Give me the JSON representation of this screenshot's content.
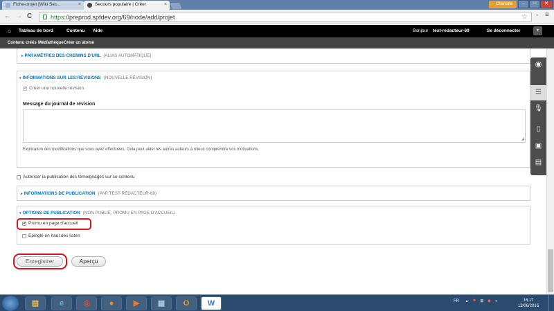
{
  "browser": {
    "tabs": [
      {
        "label": "Fiche-projet [Wiki Sec..."
      },
      {
        "label": "Secours populaire | Créer"
      }
    ],
    "tab_close": "×",
    "user_badge": "Charlotte",
    "window_controls": {
      "minimize": "–",
      "maximize": "□",
      "close": "✕"
    },
    "nav": {
      "back": "←",
      "forward": "→",
      "reload": "C"
    },
    "url_https": "https",
    "url_rest": "://preprod.spfdev.org/69/node/add/projet",
    "bookmark_star": "☆",
    "menu_icon": "≡"
  },
  "admin_toolbar": {
    "home_icon": "⌂",
    "items": [
      "Tableau de bord",
      "Contenu",
      "Aide"
    ],
    "greeting_prefix": "Bonjour",
    "username": "test-redacteur-69",
    "logout": "Se déconnecter"
  },
  "shortcuts": [
    "Contenu créés",
    "Médiathèque",
    "Créer un atome"
  ],
  "form": {
    "url_paths": {
      "title": "Paramètres des chemins d'URL",
      "summary": "(Alias automatique)"
    },
    "revisions": {
      "title": "Informations sur les révisions",
      "summary": "(Nouvelle révision)",
      "new_revision_label": "Créer une nouvelle révision",
      "new_revision_checked": true,
      "log_label": "Message du journal de révision",
      "log_value": "",
      "log_help": "Explication des modifications que vous avez effectuées. Cela peut aider les autres auteurs à mieux comprendre vos motivations."
    },
    "testimonies_label": "Autoriser la publication des témoignages sur ce contenu",
    "testimonies_checked": false,
    "authoring": {
      "title": "Informations de publication",
      "summary": "(Par test-redacteur-69)"
    },
    "publishing": {
      "title": "Options de publication",
      "summary": "(Non publié, promu en page d'accueil)",
      "promote_label": "Promu en page d'accueil",
      "promote_checked": true,
      "sticky_label": "Epinglé en haut des listes",
      "sticky_checked": false
    },
    "save_button": "Enregistrer",
    "preview_button": "Aperçu"
  },
  "highlight_color": "#d2161e",
  "taskbar": {
    "apps": [
      "explorer-icon",
      "ie-icon",
      "chrome-icon",
      "firefox-icon",
      "media-icon",
      "remote-desktop-icon",
      "outlook-icon",
      "word-icon"
    ],
    "language": "FR",
    "time": "16:17",
    "date": "13/06/2016"
  }
}
